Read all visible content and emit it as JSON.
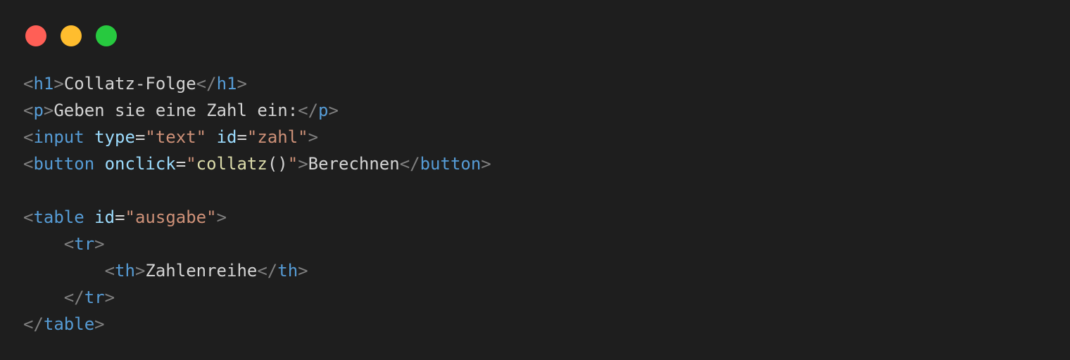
{
  "window": {
    "traffic_lights": {
      "close_color": "#ff5f56",
      "minimize_color": "#ffbd2e",
      "maximize_color": "#27c93f"
    }
  },
  "theme": {
    "background": "#1e1e1e",
    "punctuation": "#808080",
    "tag": "#569cd6",
    "attribute": "#9cdcfe",
    "string": "#ce9178",
    "function": "#dcdcaa",
    "text": "#d4d4d4"
  },
  "code": {
    "lines": [
      [
        {
          "t": "<",
          "c": "punc"
        },
        {
          "t": "h1",
          "c": "tag"
        },
        {
          "t": ">",
          "c": "punc"
        },
        {
          "t": "Collatz-Folge",
          "c": "txt"
        },
        {
          "t": "</",
          "c": "punc"
        },
        {
          "t": "h1",
          "c": "tag"
        },
        {
          "t": ">",
          "c": "punc"
        }
      ],
      [
        {
          "t": "<",
          "c": "punc"
        },
        {
          "t": "p",
          "c": "tag"
        },
        {
          "t": ">",
          "c": "punc"
        },
        {
          "t": "Geben sie eine Zahl ein:",
          "c": "txt"
        },
        {
          "t": "</",
          "c": "punc"
        },
        {
          "t": "p",
          "c": "tag"
        },
        {
          "t": ">",
          "c": "punc"
        }
      ],
      [
        {
          "t": "<",
          "c": "punc"
        },
        {
          "t": "input",
          "c": "tag"
        },
        {
          "t": " ",
          "c": "txt"
        },
        {
          "t": "type",
          "c": "attr"
        },
        {
          "t": "=",
          "c": "eq"
        },
        {
          "t": "\"text\"",
          "c": "str"
        },
        {
          "t": " ",
          "c": "txt"
        },
        {
          "t": "id",
          "c": "attr"
        },
        {
          "t": "=",
          "c": "eq"
        },
        {
          "t": "\"zahl\"",
          "c": "str"
        },
        {
          "t": ">",
          "c": "punc"
        }
      ],
      [
        {
          "t": "<",
          "c": "punc"
        },
        {
          "t": "button",
          "c": "tag"
        },
        {
          "t": " ",
          "c": "txt"
        },
        {
          "t": "onclick",
          "c": "attr"
        },
        {
          "t": "=",
          "c": "eq"
        },
        {
          "t": "\"",
          "c": "str"
        },
        {
          "t": "collatz",
          "c": "fn"
        },
        {
          "t": "()",
          "c": "txt"
        },
        {
          "t": "\"",
          "c": "str"
        },
        {
          "t": ">",
          "c": "punc"
        },
        {
          "t": "Berechnen",
          "c": "txt"
        },
        {
          "t": "</",
          "c": "punc"
        },
        {
          "t": "button",
          "c": "tag"
        },
        {
          "t": ">",
          "c": "punc"
        }
      ],
      [],
      [
        {
          "t": "<",
          "c": "punc"
        },
        {
          "t": "table",
          "c": "tag"
        },
        {
          "t": " ",
          "c": "txt"
        },
        {
          "t": "id",
          "c": "attr"
        },
        {
          "t": "=",
          "c": "eq"
        },
        {
          "t": "\"ausgabe\"",
          "c": "str"
        },
        {
          "t": ">",
          "c": "punc"
        }
      ],
      [
        {
          "t": "    ",
          "c": "txt"
        },
        {
          "t": "<",
          "c": "punc"
        },
        {
          "t": "tr",
          "c": "tag"
        },
        {
          "t": ">",
          "c": "punc"
        }
      ],
      [
        {
          "t": "        ",
          "c": "txt"
        },
        {
          "t": "<",
          "c": "punc"
        },
        {
          "t": "th",
          "c": "tag"
        },
        {
          "t": ">",
          "c": "punc"
        },
        {
          "t": "Zahlenreihe",
          "c": "txt"
        },
        {
          "t": "</",
          "c": "punc"
        },
        {
          "t": "th",
          "c": "tag"
        },
        {
          "t": ">",
          "c": "punc"
        }
      ],
      [
        {
          "t": "    ",
          "c": "txt"
        },
        {
          "t": "</",
          "c": "punc"
        },
        {
          "t": "tr",
          "c": "tag"
        },
        {
          "t": ">",
          "c": "punc"
        }
      ],
      [
        {
          "t": "</",
          "c": "punc"
        },
        {
          "t": "table",
          "c": "tag"
        },
        {
          "t": ">",
          "c": "punc"
        }
      ]
    ]
  }
}
